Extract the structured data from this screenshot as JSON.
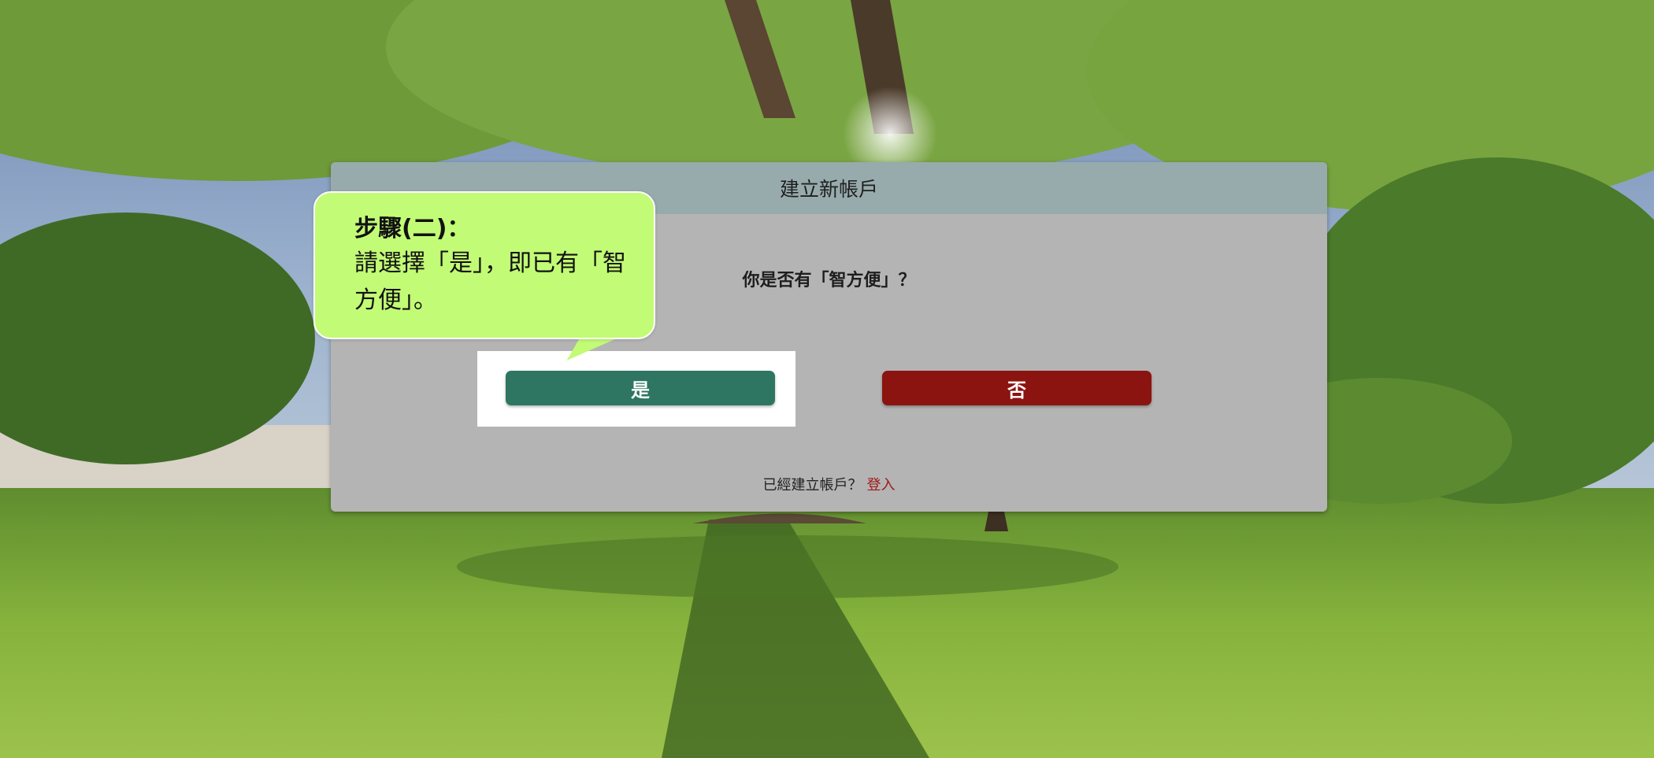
{
  "dialog": {
    "title": "建立新帳戶",
    "question": "你是否有「智方便」？",
    "yes_label": "是",
    "no_label": "否",
    "footer_text": "已經建立帳戶？",
    "login_label": "登入"
  },
  "callout": {
    "title": "步驟(二)：",
    "body": "請選擇「是」，即已有「智方便」。"
  },
  "colors": {
    "header_bg": "#97abac",
    "dialog_bg": "#b4b4b4",
    "yes_button": "#2e7662",
    "no_button": "#8b1410",
    "login_link": "#a01818",
    "callout_bg": "#c2fb75"
  }
}
